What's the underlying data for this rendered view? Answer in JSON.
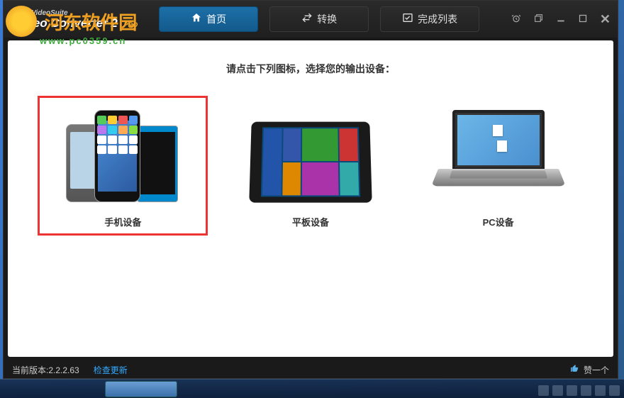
{
  "watermark": {
    "text": "河东软件园",
    "url": "www.pc0359.cn"
  },
  "app": {
    "title_small": "WiseVideoSuite",
    "title_main": "Video Converter 2",
    "badge": "PRO"
  },
  "nav": {
    "home": "首页",
    "convert": "转换",
    "complete": "完成列表"
  },
  "content": {
    "prompt": "请点击下列图标，选择您的输出设备：",
    "devices": [
      {
        "id": "phone",
        "label": "手机设备",
        "selected": true
      },
      {
        "id": "tablet",
        "label": "平板设备",
        "selected": false
      },
      {
        "id": "pc",
        "label": "PC设备",
        "selected": false
      }
    ]
  },
  "status": {
    "version_label": "当前版本:",
    "version": "2.2.2.63",
    "check_update": "检查更新",
    "like": "赞一个"
  }
}
